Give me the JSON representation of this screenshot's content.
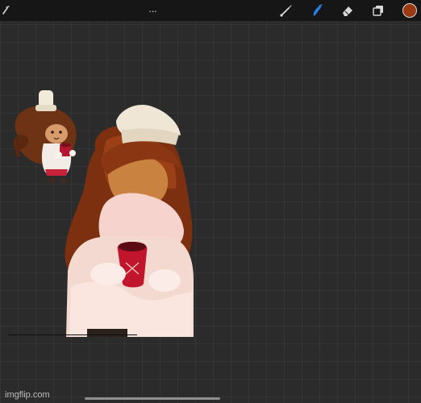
{
  "toolbar": {
    "more_label": "···",
    "icons": {
      "back": "back-wrench-icon",
      "brush": "brush-icon",
      "smudge": "smudge-icon",
      "eraser": "eraser-icon",
      "layers": "layers-icon"
    },
    "colors": {
      "active_tool": "#2a7de1",
      "inactive_tool": "#d9d9d9",
      "current_color": "#9a3a12"
    }
  },
  "canvas": {
    "background": "#2b2b2b",
    "content": {
      "small_figure": "chibi-character-with-cup",
      "large_figure": "character-holding-red-mug"
    }
  },
  "watermark": {
    "text": "imgflip.com"
  }
}
